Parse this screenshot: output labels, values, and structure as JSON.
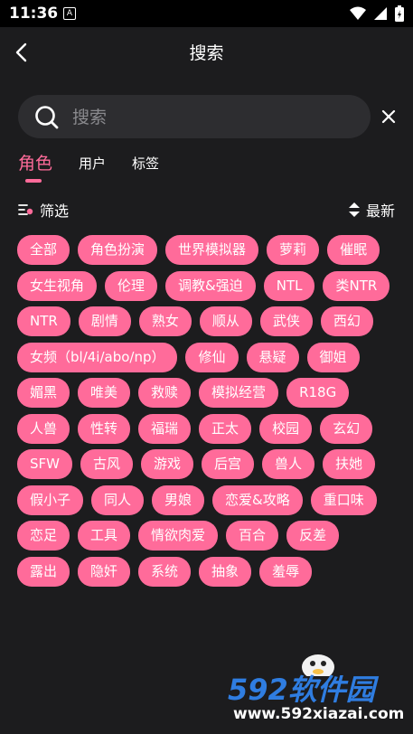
{
  "status_bar": {
    "time": "11:36",
    "notification_letter": "A"
  },
  "header": {
    "title": "搜索"
  },
  "search": {
    "placeholder": "搜索",
    "value": ""
  },
  "tabs": [
    {
      "label": "角色",
      "active": true
    },
    {
      "label": "用户",
      "active": false
    },
    {
      "label": "标签",
      "active": false
    }
  ],
  "filter": {
    "label": "筛选"
  },
  "sort": {
    "label": "最新"
  },
  "tag_rows": [
    [
      "全部",
      "角色扮演",
      "世界模拟器",
      "萝莉",
      "催眠"
    ],
    [
      "女生视角",
      "伦理",
      "调教&强迫",
      "NTL",
      "类NTR"
    ],
    [
      "NTR",
      "剧情",
      "熟女",
      "顺从",
      "武侠",
      "西幻"
    ],
    [
      "女频（bl/4i/abo/np）",
      "修仙",
      "悬疑",
      "御姐"
    ],
    [
      "媚黑",
      "唯美",
      "救赎",
      "模拟经营",
      "R18G"
    ],
    [
      "人兽",
      "性转",
      "福瑞",
      "正太",
      "校园",
      "玄幻"
    ],
    [
      "SFW",
      "古风",
      "游戏",
      "后宫",
      "兽人",
      "扶她"
    ],
    [
      "假小子",
      "同人",
      "男娘",
      "恋爱&攻略",
      "重口味"
    ],
    [
      "恋足",
      "工具",
      "情欲肉爱",
      "百合",
      "反差"
    ],
    [
      "露出",
      "隐奸",
      "系统",
      "抽象",
      "羞辱"
    ]
  ],
  "watermark": {
    "brand": "592软件园",
    "url": "www.592xiazai.com"
  },
  "colors": {
    "accent": "#ff6b9a",
    "background": "#1c1c1e",
    "search_bg": "#2d2d30",
    "watermark_blue": "#2f7de1"
  }
}
